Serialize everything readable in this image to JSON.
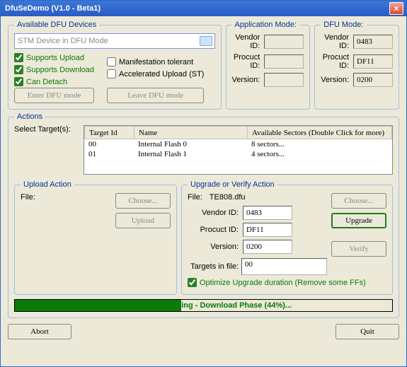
{
  "window": {
    "title": "DfuSeDemo (V1.0 - Beta1)"
  },
  "available": {
    "legend": "Available DFU Devices",
    "dropdown": "STM Device in DFU Mode",
    "supports_upload": "Supports Upload",
    "supports_download": "Supports Download",
    "can_detach": "Can Detach",
    "manifestation": "Manifestation tolerant",
    "accel_upload": "Accelerated Upload (ST)",
    "enter_btn": "Enter DFU mode",
    "leave_btn": "Leave DFU mode"
  },
  "app_mode": {
    "legend": "Application Mode:",
    "vendor_lbl": "Vendor ID:",
    "product_lbl": "Procuct ID:",
    "version_lbl": "Version:",
    "vendor": "",
    "product": "",
    "version": ""
  },
  "dfu_mode": {
    "legend": "DFU Mode:",
    "vendor_lbl": "Vendor ID:",
    "product_lbl": "Procuct ID:",
    "version_lbl": "Version:",
    "vendor": "0483",
    "product": "DF11",
    "version": "0200"
  },
  "actions": {
    "legend": "Actions",
    "select_targets": "Select Target(s):",
    "col_target": "Target Id",
    "col_name": "Name",
    "col_avail": "Available Sectors (Double Click for more)",
    "rows": [
      {
        "id": "00",
        "name": "Internal Flash 0",
        "avail": "8 sectors..."
      },
      {
        "id": "01",
        "name": "Internal Flash 1",
        "avail": "4 sectors..."
      }
    ]
  },
  "upload": {
    "legend": "Upload Action",
    "file_lbl": "File:",
    "choose": "Choose...",
    "upload": "Upload"
  },
  "upgrade": {
    "legend": "Upgrade or Verify Action",
    "file_lbl": "File:",
    "file_val": "TE808.dfu",
    "choose": "Choose...",
    "upgrade_btn": "Upgrade",
    "verify_btn": "Verify",
    "vendor_lbl": "Vendor ID:",
    "product_lbl": "Procuct ID:",
    "version_lbl": "Version:",
    "vendor": "0483",
    "product": "DF11",
    "version": "0200",
    "targets_lbl": "Targets in file:",
    "targets_val": "00",
    "optimize": "Optimize Upgrade duration (Remove some FFs)"
  },
  "progress": {
    "text": "Target 00: Upgrading - Download Phase (44%)..."
  },
  "bottom": {
    "abort": "Abort",
    "quit": "Quit"
  }
}
